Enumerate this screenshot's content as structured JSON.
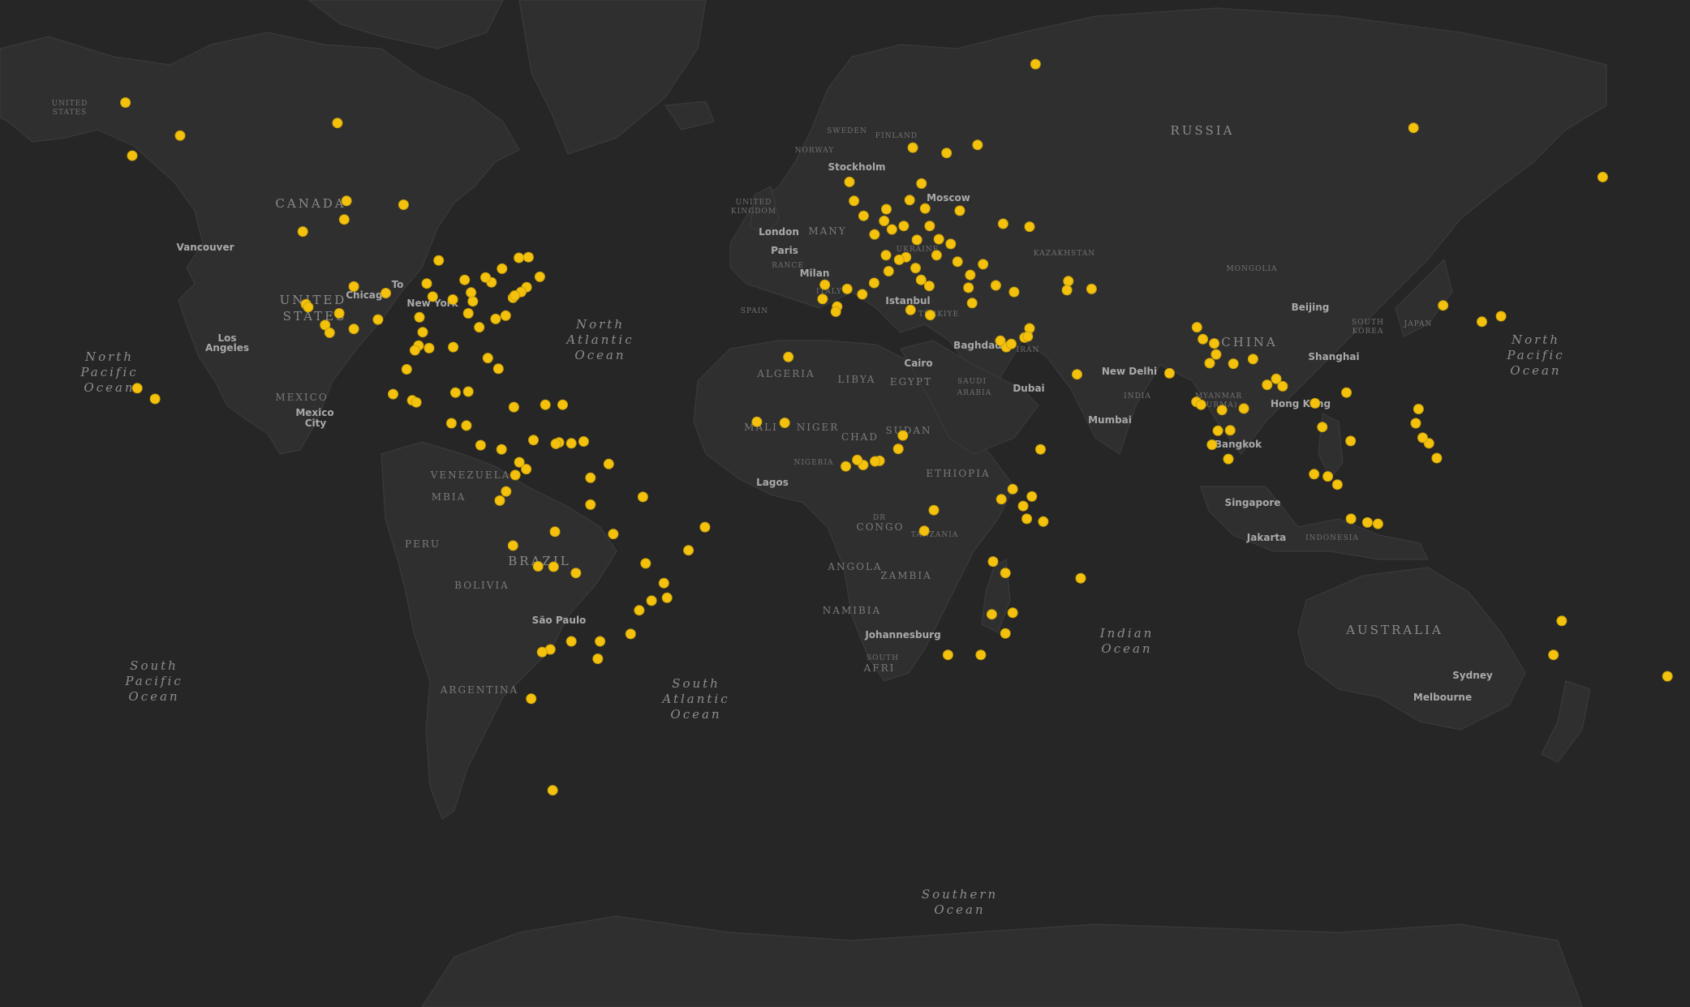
{
  "colors": {
    "ocean": "#262626",
    "land": "#2f2f2f",
    "border": "#3a3a3a",
    "marker": "#f4c20d"
  },
  "oceans": [
    {
      "id": "n-pacific-w",
      "lines": [
        "North",
        "Pacific",
        "Ocean"
      ]
    },
    {
      "id": "s-pacific",
      "lines": [
        "South",
        "Pacific",
        "Ocean"
      ]
    },
    {
      "id": "n-atlantic",
      "lines": [
        "North",
        "Atlantic",
        "Ocean"
      ]
    },
    {
      "id": "s-atlantic",
      "lines": [
        "South",
        "Atlantic",
        "Ocean"
      ]
    },
    {
      "id": "indian",
      "lines": [
        "Indian",
        "Ocean"
      ]
    },
    {
      "id": "southern",
      "lines": [
        "Southern",
        "Ocean"
      ]
    },
    {
      "id": "n-pacific-e",
      "lines": [
        "North",
        "Pacific",
        "Ocean"
      ]
    }
  ],
  "countries": [
    {
      "id": "canada",
      "text": "CANADA"
    },
    {
      "id": "us-1",
      "text": "UNITED"
    },
    {
      "id": "us-2",
      "text": "STATES"
    },
    {
      "id": "us-ak-1",
      "text": "UNITED"
    },
    {
      "id": "us-ak-2",
      "text": "STATES"
    },
    {
      "id": "mexico",
      "text": "MEXICO"
    },
    {
      "id": "venezuela",
      "text": "VENEZUELA"
    },
    {
      "id": "colombia",
      "text": "MBIA"
    },
    {
      "id": "peru",
      "text": "PERU"
    },
    {
      "id": "bolivia",
      "text": "BOLIVIA"
    },
    {
      "id": "brazil",
      "text": "BRAZIL"
    },
    {
      "id": "argentina",
      "text": "ARGENTINA"
    },
    {
      "id": "uk-1",
      "text": "UNITED"
    },
    {
      "id": "uk-2",
      "text": "KINGDOM"
    },
    {
      "id": "norway",
      "text": "NORWAY"
    },
    {
      "id": "sweden",
      "text": "SWEDEN"
    },
    {
      "id": "finland",
      "text": "FINLAND"
    },
    {
      "id": "germany",
      "text": "MANY"
    },
    {
      "id": "france",
      "text": "RANCE"
    },
    {
      "id": "spain",
      "text": "SPAIN"
    },
    {
      "id": "italy",
      "text": "ITALY"
    },
    {
      "id": "ukraine",
      "text": "UKRAINE"
    },
    {
      "id": "turkiye",
      "text": "TÜRKIYE"
    },
    {
      "id": "algeria",
      "text": "ALGERIA"
    },
    {
      "id": "libya",
      "text": "LIBYA"
    },
    {
      "id": "egypt",
      "text": "EGYPT"
    },
    {
      "id": "mali",
      "text": "MALI"
    },
    {
      "id": "niger",
      "text": "NIGER"
    },
    {
      "id": "chad",
      "text": "CHAD"
    },
    {
      "id": "sudan",
      "text": "SUDAN"
    },
    {
      "id": "nigeria",
      "text": "NIGERIA"
    },
    {
      "id": "ethiopia",
      "text": "ETHIOPIA"
    },
    {
      "id": "drc-1",
      "text": "DR"
    },
    {
      "id": "drc-2",
      "text": "CONGO"
    },
    {
      "id": "tanzania",
      "text": "TANZANIA"
    },
    {
      "id": "angola",
      "text": "ANGOLA"
    },
    {
      "id": "zambia",
      "text": "ZAMBIA"
    },
    {
      "id": "namibia",
      "text": "NAMIBIA"
    },
    {
      "id": "sa-1",
      "text": "SOUTH"
    },
    {
      "id": "sa-2",
      "text": "AFRI"
    },
    {
      "id": "saudi-1",
      "text": "SAUDI"
    },
    {
      "id": "saudi-2",
      "text": "ARABIA"
    },
    {
      "id": "iran",
      "text": "IRAN"
    },
    {
      "id": "kazakhstan",
      "text": "KAZAKHSTAN"
    },
    {
      "id": "mongolia",
      "text": "MONGOLIA"
    },
    {
      "id": "russia",
      "text": "RUSSIA"
    },
    {
      "id": "china",
      "text": "CHINA"
    },
    {
      "id": "india",
      "text": "INDIA"
    },
    {
      "id": "myanmar-1",
      "text": "MYANMAR"
    },
    {
      "id": "myanmar-2",
      "text": "(BURMA)"
    },
    {
      "id": "indonesia",
      "text": "INDONESIA"
    },
    {
      "id": "japan",
      "text": "JAPAN"
    },
    {
      "id": "skorea-1",
      "text": "SOUTH"
    },
    {
      "id": "skorea-2",
      "text": "KOREA"
    },
    {
      "id": "australia",
      "text": "AUSTRALIA"
    }
  ],
  "cities": [
    {
      "id": "vancouver",
      "text": "Vancouver"
    },
    {
      "id": "chicago",
      "text": "Chicago"
    },
    {
      "id": "toronto",
      "text": "To"
    },
    {
      "id": "newyork",
      "text": "New York"
    },
    {
      "id": "la-1",
      "text": "Los"
    },
    {
      "id": "la-2",
      "text": "Angeles"
    },
    {
      "id": "mexicocity-1",
      "text": "Mexico"
    },
    {
      "id": "mexicocity-2",
      "text": "City"
    },
    {
      "id": "saopaulo",
      "text": "São Paulo"
    },
    {
      "id": "london",
      "text": "London"
    },
    {
      "id": "paris",
      "text": "Paris"
    },
    {
      "id": "milan",
      "text": "Milan"
    },
    {
      "id": "stockholm",
      "text": "Stockholm"
    },
    {
      "id": "moscow",
      "text": "Moscow"
    },
    {
      "id": "istanbul",
      "text": "Istanbul"
    },
    {
      "id": "cairo",
      "text": "Cairo"
    },
    {
      "id": "baghdad",
      "text": "Baghdad"
    },
    {
      "id": "dubai",
      "text": "Dubai"
    },
    {
      "id": "lagos",
      "text": "Lagos"
    },
    {
      "id": "johannesburg",
      "text": "Johannesburg"
    },
    {
      "id": "newdelhi",
      "text": "New Delhi"
    },
    {
      "id": "mumbai",
      "text": "Mumbai"
    },
    {
      "id": "beijing",
      "text": "Beijing"
    },
    {
      "id": "shanghai",
      "text": "Shanghai"
    },
    {
      "id": "hongkong",
      "text": "Hong Kong"
    },
    {
      "id": "bangkok",
      "text": "Bangkok"
    },
    {
      "id": "singapore",
      "text": "Singapore"
    },
    {
      "id": "jakarta",
      "text": "Jakarta"
    },
    {
      "id": "sydney",
      "text": "Sydney"
    },
    {
      "id": "melbourne",
      "text": "Melbourne"
    }
  ],
  "markers": [
    [
      -160.5,
      59.0
    ],
    [
      -150.0,
      61.2
    ],
    [
      -159.4,
      21.9
    ],
    [
      -155.5,
      19.7
    ],
    [
      -162,
      64.5
    ],
    [
      -115.5,
      62.5
    ],
    [
      -101.0,
      53.0
    ],
    [
      -123.1,
      49.3
    ],
    [
      -114.0,
      51.0
    ],
    [
      -113.5,
      53.5
    ],
    [
      -122.4,
      37.8
    ],
    [
      -121.9,
      37.3
    ],
    [
      -118.2,
      34.1
    ],
    [
      -117.2,
      32.7
    ],
    [
      -115.1,
      36.2
    ],
    [
      -111.9,
      33.4
    ],
    [
      -111.9,
      40.8
    ],
    [
      -104.9,
      39.7
    ],
    [
      -106.6,
      35.1
    ],
    [
      -97.7,
      30.3
    ],
    [
      -96.8,
      32.8
    ],
    [
      -95.4,
      29.8
    ],
    [
      -90.1,
      30.0
    ],
    [
      -94.6,
      39.1
    ],
    [
      -93.3,
      45.0
    ],
    [
      -87.6,
      41.9
    ],
    [
      -86.2,
      39.8
    ],
    [
      -84.4,
      33.7
    ],
    [
      -80.8,
      35.2
    ],
    [
      -80.2,
      25.8
    ],
    [
      -81.7,
      41.5
    ],
    [
      -83.0,
      42.3
    ],
    [
      -79.4,
      43.7
    ],
    [
      -75.7,
      45.4
    ],
    [
      -73.6,
      45.5
    ],
    [
      -71.1,
      42.4
    ],
    [
      -74.0,
      40.7
    ],
    [
      -75.2,
      39.9
    ],
    [
      -77.0,
      38.9
    ],
    [
      -76.6,
      39.3
    ],
    [
      -78.6,
      35.8
    ],
    [
      -82.5,
      27.9
    ],
    [
      -90.2,
      38.6
    ],
    [
      -86.8,
      36.2
    ],
    [
      -85.8,
      38.3
    ],
    [
      -95.9,
      41.3
    ],
    [
      -97.5,
      35.5
    ],
    [
      -98.5,
      29.4
    ],
    [
      -100.3,
      25.7
    ],
    [
      -103.3,
      20.7
    ],
    [
      -99.1,
      19.4
    ],
    [
      -98.2,
      19.0
    ],
    [
      -89.6,
      21.0
    ],
    [
      -86.8,
      21.2
    ],
    [
      -90.5,
      14.6
    ],
    [
      -87.2,
      14.1
    ],
    [
      -84.1,
      9.9
    ],
    [
      -79.5,
      9.0
    ],
    [
      -76.8,
      18.0
    ],
    [
      -69.9,
      18.5
    ],
    [
      -66.1,
      18.5
    ],
    [
      -75.6,
      6.2
    ],
    [
      -74.1,
      4.7
    ],
    [
      -76.5,
      3.4
    ],
    [
      -66.9,
      10.5
    ],
    [
      -67.6,
      10.2
    ],
    [
      -64.2,
      10.3
    ],
    [
      -61.5,
      10.7
    ],
    [
      -72.5,
      11.0
    ],
    [
      -78.5,
      -0.2
    ],
    [
      -79.9,
      -2.2
    ],
    [
      -77.0,
      -12.0
    ],
    [
      -71.5,
      -16.4
    ],
    [
      -68.1,
      -16.5
    ],
    [
      -63.2,
      -17.8
    ],
    [
      -58.4,
      -34.6
    ],
    [
      -57.9,
      -31.4
    ],
    [
      -64.2,
      -31.4
    ],
    [
      -68.8,
      -32.9
    ],
    [
      -70.6,
      -33.4
    ],
    [
      -46.6,
      -23.5
    ],
    [
      -43.2,
      -22.9
    ],
    [
      -43.9,
      -19.9
    ],
    [
      -38.5,
      -13.0
    ],
    [
      -34.9,
      -8.0
    ],
    [
      -47.9,
      -15.8
    ],
    [
      -49.3,
      -25.4
    ],
    [
      -51.2,
      -30.0
    ],
    [
      -60.0,
      -3.1
    ],
    [
      -48.5,
      -1.4
    ],
    [
      -67.8,
      -9.0
    ],
    [
      -55.0,
      -9.5
    ],
    [
      -56.0,
      5.8
    ],
    [
      -60.0,
      2.8
    ],
    [
      -68.3,
      -54.8
    ],
    [
      -73.0,
      -41.5
    ],
    [
      -23.5,
      14.9
    ],
    [
      -16.6,
      28.1
    ],
    [
      -9.1,
      38.7
    ],
    [
      -8.6,
      41.1
    ],
    [
      -3.7,
      40.4
    ],
    [
      -5.9,
      37.4
    ],
    [
      2.2,
      41.4
    ],
    [
      -0.4,
      39.5
    ],
    [
      -6.2,
      36.5
    ],
    [
      2.3,
      48.9
    ],
    [
      4.8,
      45.8
    ],
    [
      5.4,
      43.3
    ],
    [
      -0.1,
      51.5
    ],
    [
      -2.2,
      53.5
    ],
    [
      -3.2,
      55.9
    ],
    [
      4.9,
      52.4
    ],
    [
      4.4,
      50.8
    ],
    [
      6.1,
      49.6
    ],
    [
      8.7,
      50.1
    ],
    [
      11.6,
      48.1
    ],
    [
      13.4,
      52.5
    ],
    [
      10.0,
      53.6
    ],
    [
      9.2,
      45.5
    ],
    [
      7.7,
      45.1
    ],
    [
      11.3,
      43.8
    ],
    [
      12.5,
      41.9
    ],
    [
      14.3,
      40.9
    ],
    [
      18.1,
      59.3
    ],
    [
      24.9,
      60.2
    ],
    [
      10.7,
      59.9
    ],
    [
      12.6,
      55.7
    ],
    [
      21.0,
      52.2
    ],
    [
      14.4,
      50.1
    ],
    [
      16.4,
      48.2
    ],
    [
      19.0,
      47.5
    ],
    [
      26.1,
      44.4
    ],
    [
      23.3,
      42.7
    ],
    [
      20.5,
      44.8
    ],
    [
      15.9,
      45.8
    ],
    [
      23.7,
      38.0
    ],
    [
      22.9,
      40.6
    ],
    [
      28.9,
      41.0
    ],
    [
      32.9,
      39.9
    ],
    [
      30.5,
      50.4
    ],
    [
      36.3,
      50.0
    ],
    [
      44.8,
      41.7
    ],
    [
      44.5,
      40.2
    ],
    [
      49.9,
      40.4
    ],
    [
      46.7,
      24.7
    ],
    [
      31.2,
      30.0
    ],
    [
      29.9,
      31.2
    ],
    [
      32.3,
      30.6
    ],
    [
      35.2,
      31.8
    ],
    [
      36.3,
      33.5
    ],
    [
      35.9,
      32.0
    ],
    [
      14.5,
      35.9
    ],
    [
      10.2,
      36.8
    ],
    [
      3.4,
      6.5
    ],
    [
      -0.2,
      5.6
    ],
    [
      2.4,
      6.4
    ],
    [
      7.5,
      9.1
    ],
    [
      8.5,
      12.0
    ],
    [
      -4.0,
      5.3
    ],
    [
      -1.5,
      6.7
    ],
    [
      -17.4,
      14.7
    ],
    [
      38.7,
      9.0
    ],
    [
      32.6,
      0.3
    ],
    [
      36.8,
      -1.3
    ],
    [
      39.3,
      -6.8
    ],
    [
      35.7,
      -6.2
    ],
    [
      34.9,
      -3.4
    ],
    [
      30.1,
      -1.9
    ],
    [
      31.0,
      -17.8
    ],
    [
      28.3,
      -15.4
    ],
    [
      32.6,
      -25.9
    ],
    [
      28.0,
      -26.2
    ],
    [
      31.0,
      -29.9
    ],
    [
      18.4,
      -33.9
    ],
    [
      25.6,
      -33.9
    ],
    [
      47.5,
      -18.9
    ],
    [
      13.2,
      -8.8
    ],
    [
      15.3,
      -4.3
    ],
    [
      77.2,
      28.6
    ],
    [
      76.8,
      30.7
    ],
    [
      75.8,
      26.9
    ],
    [
      72.9,
      19.1
    ],
    [
      73.9,
      18.5
    ],
    [
      77.6,
      13.0
    ],
    [
      80.3,
      13.1
    ],
    [
      76.3,
      10.0
    ],
    [
      78.5,
      17.4
    ],
    [
      88.4,
      22.6
    ],
    [
      85.3,
      27.7
    ],
    [
      90.4,
      23.8
    ],
    [
      91.8,
      22.3
    ],
    [
      81.0,
      26.8
    ],
    [
      73.0,
      33.7
    ],
    [
      74.3,
      31.5
    ],
    [
      67.0,
      24.9
    ],
    [
      79.9,
      6.9
    ],
    [
      83.3,
      17.7
    ],
    [
      100.5,
      13.8
    ],
    [
      98.9,
      18.8
    ],
    [
      105.8,
      21.0
    ],
    [
      106.7,
      10.8
    ],
    [
      103.8,
      1.3
    ],
    [
      101.7,
      3.1
    ],
    [
      106.8,
      -6.2
    ],
    [
      110.4,
      -7.0
    ],
    [
      112.7,
      -7.3
    ],
    [
      98.7,
      3.6
    ],
    [
      121.0,
      14.6
    ],
    [
      123.9,
      10.3
    ],
    [
      125.6,
      7.1
    ],
    [
      121.6,
      17.6
    ],
    [
      122.5,
      11.5
    ],
    [
      127.0,
      37.6
    ],
    [
      139.7,
      35.7
    ],
    [
      135.5,
      34.7
    ],
    [
      151.2,
      -33.9
    ],
    [
      153.0,
      -27.5
    ],
    [
      176.2,
      -37.7
    ],
    [
      37.6,
      67.9
    ],
    [
      120.5,
      62.0
    ],
    [
      162.0,
      56.5
    ]
  ]
}
